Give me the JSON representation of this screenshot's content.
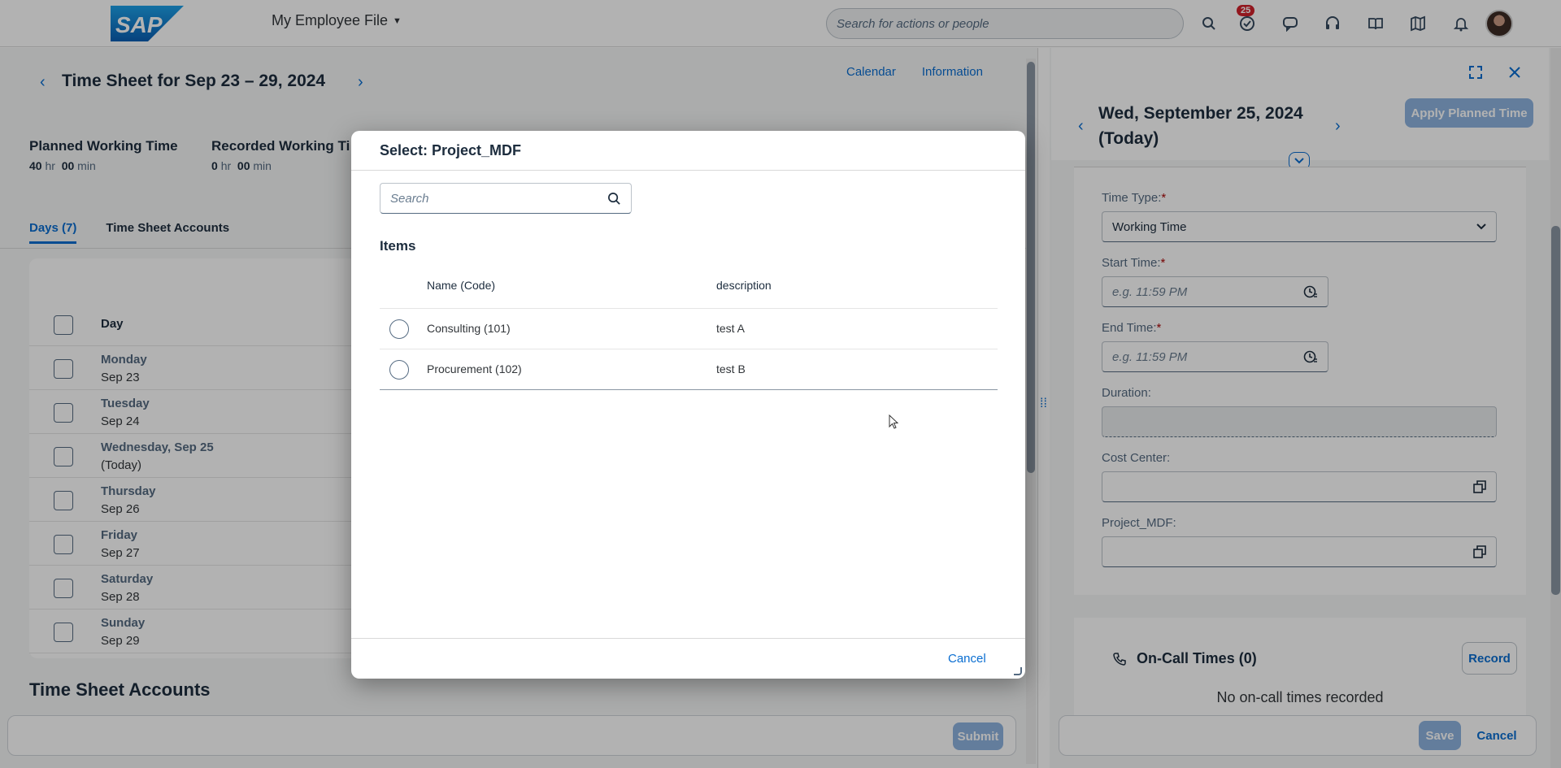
{
  "shell": {
    "logo_text": "SAP",
    "app_title": "My Employee File",
    "search_placeholder": "Search for actions or people",
    "notification_count": "25"
  },
  "timesheet": {
    "title": "Time Sheet for Sep 23 – 29, 2024",
    "links": [
      "Calendar",
      "Information"
    ],
    "kpis": [
      {
        "label": "Planned Working Time",
        "hr": "40",
        "hr_unit": "hr",
        "min": "00",
        "min_unit": "min"
      },
      {
        "label": "Recorded Working Ti",
        "hr": "0",
        "hr_unit": "hr",
        "min": "00",
        "min_unit": "min"
      }
    ],
    "tabs": [
      "Days (7)",
      "Time Sheet Accounts"
    ],
    "day_column_header": "Day",
    "days": [
      {
        "name": "Monday",
        "date": "Sep 23"
      },
      {
        "name": "Tuesday",
        "date": "Sep 24"
      },
      {
        "name": "Wednesday, Sep 25",
        "date": "(Today)"
      },
      {
        "name": "Thursday",
        "date": "Sep 26"
      },
      {
        "name": "Friday",
        "date": "Sep 27"
      },
      {
        "name": "Saturday",
        "date": "Sep 28"
      },
      {
        "name": "Sunday",
        "date": "Sep 29"
      }
    ],
    "accounts_title": "Time Sheet Accounts",
    "submit_label": "Submit"
  },
  "detail": {
    "date_line1": "Wed, September 25, 2024",
    "date_line2": "(Today)",
    "apply_label": "Apply Planned Time",
    "fields": {
      "time_type_label": "Time Type:",
      "time_type_value": "Working Time",
      "start_label": "Start Time:",
      "start_placeholder": "e.g. 11:59 PM",
      "end_label": "End Time:",
      "end_placeholder": "e.g. 11:59 PM",
      "duration_label": "Duration:",
      "cost_center_label": "Cost Center:",
      "project_label": "Project_MDF:"
    },
    "oncall_title": "On-Call Times (0)",
    "record_label": "Record",
    "oncall_empty": "No on-call times recorded",
    "save_label": "Save",
    "cancel_label": "Cancel"
  },
  "dialog": {
    "title": "Select: Project_MDF",
    "search_placeholder": "Search",
    "items_title": "Items",
    "columns": [
      "Name (Code)",
      "description"
    ],
    "rows": [
      {
        "name": "Consulting (101)",
        "description": "test A"
      },
      {
        "name": "Procurement (102)",
        "description": "test B"
      }
    ],
    "cancel_label": "Cancel"
  },
  "colors": {
    "accent": "#0a6ed1",
    "required": "#aa0808",
    "badge": "#d1212b",
    "disabled_button": "#8fb4e0"
  }
}
